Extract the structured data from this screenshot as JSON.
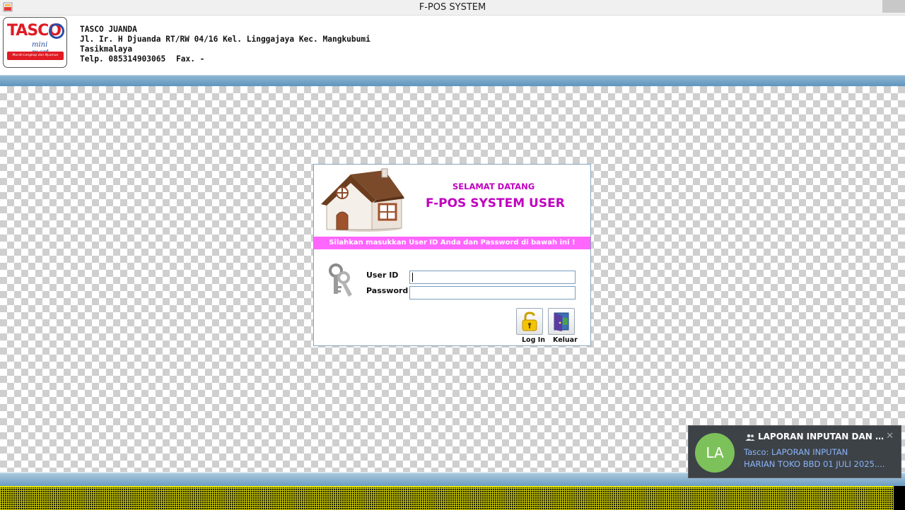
{
  "window": {
    "title": "F-POS SYSTEM"
  },
  "store": {
    "logo_text": "TASCO",
    "logo_sub": "mini mart",
    "logo_tagline": "Murah Lengkap dan Nyaman",
    "name": "TASCO JUANDA",
    "address": "Jl. Ir. H Djuanda RT/RW 04/16 Kel. Linggajaya Kec. Mangkubumi",
    "city": "Tasikmalaya",
    "phone": "Telp. 085314903065",
    "fax": "Fax. -"
  },
  "login": {
    "welcome": "SELAMAT DATANG",
    "title": "F-POS SYSTEM USER",
    "instruction": "Silahkan masukkan User ID Anda dan Password di bawah ini !",
    "user_label": "User ID",
    "password_label": "Password",
    "user_value": "",
    "password_value": "",
    "login_label": "Log In",
    "exit_label": "Keluar"
  },
  "notification": {
    "avatar": "LA",
    "header": "LAPORAN INPUTAN DAN IN...",
    "body_line1": "Tasco: LAPORAN INPUTAN",
    "body_line2": "HARIAN TOKO BBD 01 JULI 2025....",
    "close": "✕"
  },
  "colors": {
    "accent_magenta": "#c000c0",
    "instruction_bar": "#ff66ff",
    "avatar_green": "#7dc15a",
    "link_blue": "#8ab4f8"
  }
}
